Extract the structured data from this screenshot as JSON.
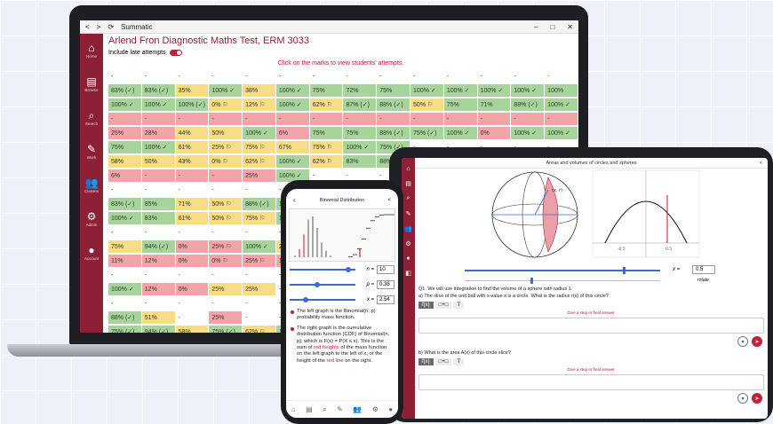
{
  "laptop": {
    "window_title": "Summatic",
    "nav_back": "<",
    "nav_forward": ">",
    "refresh_icon": "refresh-icon",
    "win_controls": [
      "–",
      "□",
      "✕"
    ],
    "test_title": "Arlend Fron Diagnostic Maths Test, ERM 3033",
    "late_attempts_label": "Include late attempts",
    "late_attempts_on": true,
    "hint": "Click on the marks to view students' attempts.",
    "sidebar": [
      {
        "icon": "home-icon",
        "glyph": "⌂",
        "label": "Home"
      },
      {
        "icon": "book-icon",
        "glyph": "▤",
        "label": "Browse"
      },
      {
        "icon": "search-icon",
        "glyph": "⌕",
        "label": "Search"
      },
      {
        "icon": "work-icon",
        "glyph": "✎",
        "label": "Work"
      },
      {
        "icon": "classes-icon",
        "glyph": "👥",
        "label": "Classes"
      },
      {
        "icon": "admin-icon",
        "glyph": "⚙",
        "label": "Admin"
      },
      {
        "icon": "account-icon",
        "glyph": "●",
        "label": "Account"
      }
    ],
    "grid": [
      [
        [
          "-",
          "n"
        ],
        [
          "-",
          "n"
        ],
        [
          "-",
          "n"
        ],
        [
          "-",
          "n"
        ],
        [
          "-",
          "n"
        ],
        [
          "-",
          "n"
        ],
        [
          "-",
          "n"
        ],
        [
          "-",
          "n"
        ],
        [
          "-",
          "n"
        ],
        [
          "-",
          "n"
        ],
        [
          "-",
          "n"
        ],
        [
          "-",
          "n"
        ],
        [
          "-",
          "n"
        ],
        [
          "-",
          "n"
        ]
      ],
      [
        [
          "83% (✓)",
          "g"
        ],
        [
          "83% (✓)",
          "g"
        ],
        [
          "35%",
          "y"
        ],
        [
          "100% ✓",
          "g"
        ],
        [
          "38%",
          "y"
        ],
        [
          "100% ✓",
          "g"
        ],
        [
          "75%",
          "g"
        ],
        [
          "72%",
          "g"
        ],
        [
          "75%",
          "g"
        ],
        [
          "100% ✓",
          "g"
        ],
        [
          "100% ✓",
          "g"
        ],
        [
          "100% ✓",
          "g"
        ],
        [
          "100% ✓",
          "g"
        ],
        [
          "100%",
          "g"
        ]
      ],
      [
        [
          "100% ✓",
          "g"
        ],
        [
          "100% ✓",
          "g"
        ],
        [
          "100% (✓)",
          "g"
        ],
        [
          "0% ⚐",
          "y"
        ],
        [
          "12% ⚐",
          "y"
        ],
        [
          "100% ✓",
          "g"
        ],
        [
          "62% ⚐",
          "y"
        ],
        [
          "87% (✓)",
          "g"
        ],
        [
          "88% (✓)",
          "g"
        ],
        [
          "50% ⚐",
          "y"
        ],
        [
          "75%",
          "g"
        ],
        [
          "71%",
          "g"
        ],
        [
          "88% (✓)",
          "g"
        ],
        [
          "100% ✓",
          "g"
        ]
      ],
      [
        [
          "-",
          "r"
        ],
        [
          "-",
          "r"
        ],
        [
          "-",
          "r"
        ],
        [
          "-",
          "r"
        ],
        [
          "-",
          "r"
        ],
        [
          "-",
          "r"
        ],
        [
          "-",
          "r"
        ],
        [
          "-",
          "r"
        ],
        [
          "-",
          "r"
        ],
        [
          "-",
          "r"
        ],
        [
          "-",
          "r"
        ],
        [
          "-",
          "r"
        ],
        [
          "-",
          "r"
        ],
        [
          "-",
          "r"
        ]
      ],
      [
        [
          "25%",
          "r"
        ],
        [
          "28%",
          "r"
        ],
        [
          "44%",
          "y"
        ],
        [
          "50%",
          "y"
        ],
        [
          "100% ✓",
          "g"
        ],
        [
          "6%",
          "r"
        ],
        [
          "75%",
          "g"
        ],
        [
          "75%",
          "g"
        ],
        [
          "88% (✓)",
          "g"
        ],
        [
          "75% (✓)",
          "g"
        ],
        [
          "100% ✓",
          "g"
        ],
        [
          "0%",
          "r"
        ],
        [
          "100% ✓",
          "g"
        ],
        [
          "100% ✓",
          "g"
        ]
      ],
      [
        [
          "75%",
          "g"
        ],
        [
          "100% ✓",
          "g"
        ],
        [
          "61%",
          "y"
        ],
        [
          "25% ⚐",
          "y"
        ],
        [
          "75% ⚐",
          "y"
        ],
        [
          "67%",
          "y"
        ],
        [
          "75% ⚐",
          "y"
        ],
        [
          "100% ✓",
          "g"
        ],
        [
          "75% (✓)",
          "g"
        ],
        [
          "-",
          "n"
        ],
        [
          "-",
          "n"
        ],
        [
          "-",
          "n"
        ],
        [
          "-",
          "n"
        ],
        [
          "-",
          "n"
        ]
      ],
      [
        [
          "58%",
          "y"
        ],
        [
          "50%",
          "y"
        ],
        [
          "43%",
          "y"
        ],
        [
          "0% ⚐",
          "y"
        ],
        [
          "62% ⚐",
          "y"
        ],
        [
          "100% ✓",
          "g"
        ],
        [
          "62% ⚐",
          "y"
        ],
        [
          "83%",
          "g"
        ],
        [
          "88% (✓)",
          "g"
        ],
        [
          "-",
          "n"
        ],
        [
          "-",
          "n"
        ],
        [
          "-",
          "n"
        ],
        [
          "-",
          "n"
        ],
        [
          "-",
          "n"
        ]
      ],
      [
        [
          "6%",
          "r"
        ],
        [
          "-",
          "r"
        ],
        [
          "-",
          "r"
        ],
        [
          "-",
          "r"
        ],
        [
          "25%",
          "r"
        ],
        [
          "100% ✓",
          "g"
        ],
        [
          "-",
          "n"
        ],
        [
          "-",
          "n"
        ],
        [
          "-",
          "n"
        ],
        [
          "-",
          "n"
        ],
        [
          "-",
          "n"
        ],
        [
          "-",
          "n"
        ],
        [
          "-",
          "n"
        ],
        [
          "-",
          "n"
        ]
      ],
      [
        [
          "-",
          "n"
        ],
        [
          "-",
          "n"
        ],
        [
          "-",
          "n"
        ],
        [
          "-",
          "n"
        ],
        [
          "-",
          "n"
        ],
        [
          "-",
          "n"
        ],
        [
          "-",
          "n"
        ],
        [
          "-",
          "n"
        ],
        [
          "-",
          "n"
        ],
        [
          "-",
          "n"
        ],
        [
          "-",
          "n"
        ],
        [
          "-",
          "n"
        ],
        [
          "-",
          "n"
        ],
        [
          "-",
          "n"
        ]
      ],
      [
        [
          "83% (✓)",
          "g"
        ],
        [
          "85%",
          "g"
        ],
        [
          "71%",
          "y"
        ],
        [
          "50% ⚐",
          "y"
        ],
        [
          "88% (✓)",
          "g"
        ],
        [
          "100% ✓",
          "g"
        ],
        [
          "-",
          "n"
        ],
        [
          "-",
          "n"
        ],
        [
          "-",
          "n"
        ],
        [
          "-",
          "n"
        ],
        [
          "-",
          "n"
        ],
        [
          "-",
          "n"
        ],
        [
          "-",
          "n"
        ],
        [
          "-",
          "n"
        ]
      ],
      [
        [
          "100% ✓",
          "g"
        ],
        [
          "83%",
          "g"
        ],
        [
          "61%",
          "y"
        ],
        [
          "50% ⚐",
          "y"
        ],
        [
          "75% ⚐",
          "y"
        ],
        [
          "100% ✓",
          "g"
        ],
        [
          "-",
          "n"
        ],
        [
          "-",
          "n"
        ],
        [
          "-",
          "n"
        ],
        [
          "-",
          "n"
        ],
        [
          "-",
          "n"
        ],
        [
          "-",
          "n"
        ],
        [
          "-",
          "n"
        ],
        [
          "-",
          "n"
        ]
      ],
      [
        [
          "-",
          "n"
        ],
        [
          "-",
          "n"
        ],
        [
          "-",
          "n"
        ],
        [
          "-",
          "n"
        ],
        [
          "-",
          "n"
        ],
        [
          "-",
          "n"
        ],
        [
          "-",
          "n"
        ],
        [
          "-",
          "n"
        ],
        [
          "-",
          "n"
        ],
        [
          "-",
          "n"
        ],
        [
          "-",
          "n"
        ],
        [
          "-",
          "n"
        ],
        [
          "-",
          "n"
        ],
        [
          "-",
          "n"
        ]
      ],
      [
        [
          "75%",
          "y"
        ],
        [
          "94% (✓)",
          "g"
        ],
        [
          "0%",
          "r"
        ],
        [
          "25% ⚐",
          "r"
        ],
        [
          "100% ✓",
          "g"
        ],
        [
          "25%",
          "y"
        ],
        [
          "-",
          "n"
        ],
        [
          "-",
          "n"
        ],
        [
          "-",
          "n"
        ],
        [
          "-",
          "n"
        ],
        [
          "-",
          "n"
        ],
        [
          "-",
          "n"
        ],
        [
          "-",
          "n"
        ],
        [
          "-",
          "n"
        ]
      ],
      [
        [
          "11%",
          "r"
        ],
        [
          "12%",
          "r"
        ],
        [
          "0%",
          "r"
        ],
        [
          "0% ⚐",
          "r"
        ],
        [
          "25% ⚐",
          "r"
        ],
        [
          "12%",
          "r"
        ],
        [
          "-",
          "n"
        ],
        [
          "-",
          "n"
        ],
        [
          "-",
          "n"
        ],
        [
          "-",
          "n"
        ],
        [
          "-",
          "n"
        ],
        [
          "-",
          "n"
        ],
        [
          "-",
          "n"
        ],
        [
          "-",
          "n"
        ]
      ],
      [
        [
          "-",
          "n"
        ],
        [
          "-",
          "n"
        ],
        [
          "-",
          "n"
        ],
        [
          "-",
          "n"
        ],
        [
          "-",
          "n"
        ],
        [
          "-",
          "n"
        ],
        [
          "-",
          "n"
        ],
        [
          "-",
          "n"
        ],
        [
          "-",
          "n"
        ],
        [
          "-",
          "n"
        ],
        [
          "-",
          "n"
        ],
        [
          "-",
          "n"
        ],
        [
          "-",
          "n"
        ],
        [
          "-",
          "n"
        ]
      ],
      [
        [
          "100% ✓",
          "g"
        ],
        [
          "12%",
          "r"
        ],
        [
          "0%",
          "r"
        ],
        [
          "25%",
          "y"
        ],
        [
          "25%",
          "y"
        ],
        [
          "-",
          "n"
        ],
        [
          "-",
          "n"
        ],
        [
          "-",
          "n"
        ],
        [
          "-",
          "n"
        ],
        [
          "-",
          "n"
        ],
        [
          "-",
          "n"
        ],
        [
          "-",
          "n"
        ],
        [
          "-",
          "n"
        ],
        [
          "-",
          "n"
        ]
      ],
      [
        [
          "-",
          "n"
        ],
        [
          "-",
          "n"
        ],
        [
          "-",
          "n"
        ],
        [
          "-",
          "n"
        ],
        [
          "-",
          "n"
        ],
        [
          "-",
          "n"
        ],
        [
          "-",
          "n"
        ],
        [
          "-",
          "n"
        ],
        [
          "-",
          "n"
        ],
        [
          "-",
          "n"
        ],
        [
          "-",
          "n"
        ],
        [
          "-",
          "n"
        ],
        [
          "-",
          "n"
        ],
        [
          "-",
          "n"
        ]
      ],
      [
        [
          "88% (✓)",
          "g"
        ],
        [
          "51%",
          "y"
        ],
        [
          "-",
          "n"
        ],
        [
          "25%",
          "r"
        ],
        [
          "-",
          "n"
        ],
        [
          "-",
          "n"
        ],
        [
          "-",
          "n"
        ],
        [
          "-",
          "n"
        ],
        [
          "-",
          "n"
        ],
        [
          "-",
          "n"
        ],
        [
          "-",
          "n"
        ],
        [
          "-",
          "n"
        ],
        [
          "-",
          "n"
        ],
        [
          "-",
          "n"
        ]
      ],
      [
        [
          "75% (✓)",
          "g"
        ],
        [
          "94% (✓)",
          "g"
        ],
        [
          "58%",
          "y"
        ],
        [
          "75% (✓)",
          "g"
        ],
        [
          "62% ⚐",
          "y"
        ],
        [
          "100% ✓",
          "g"
        ],
        [
          "-",
          "n"
        ],
        [
          "-",
          "n"
        ],
        [
          "-",
          "n"
        ],
        [
          "-",
          "n"
        ],
        [
          "-",
          "n"
        ],
        [
          "-",
          "n"
        ],
        [
          "-",
          "n"
        ],
        [
          "-",
          "n"
        ]
      ]
    ]
  },
  "tablet": {
    "title": "Areas and volumes of circles and spheres",
    "share_icon": "share-icon",
    "point_label": "(x, r)",
    "axis_ticks": [
      "-0.5",
      "0.5"
    ],
    "x_label": "x =",
    "x_value": "0.5",
    "rotate_label": "rotate",
    "question_intro": "Q1. We will use integration to find the volume of a sphere with radius 1.",
    "part_a": "a) The slice of the unit ball with x-value x is a circle. What is the radius r(x) of this circle?",
    "part_b": "b) What is the area A(x) of this circle slice?",
    "tools": [
      "f(x)",
      "□+□",
      "T"
    ],
    "step_hint": "Give a step or final answer.",
    "sidebar_glyphs": [
      "⌂",
      "▤",
      "⌕",
      "✎",
      "👥",
      "⚙",
      "●",
      "◧"
    ]
  },
  "phone": {
    "title": "Binomial Distribution",
    "back": "‹",
    "share": "<",
    "sliders": [
      {
        "var": "n =",
        "value": "10",
        "level": 0.85
      },
      {
        "var": "p =",
        "value": "0.38",
        "level": 0.38
      },
      {
        "var": "x =",
        "value": "2.54",
        "level": 0.2
      }
    ],
    "text1": "The left graph is the Binomial(n, p) probability mass function.",
    "text2_a": "The right graph is the cumulative distribution function (CDF) of Binomial(n, p), which is F(x) = P(X ≤ x). This is the sum of",
    "text2_red1": "red heights",
    "text2_b": "of the mass function on the left graph to the left of x, or the height of the",
    "text2_red2": "red line",
    "text2_c": "on the right.",
    "pmf": [
      0.01,
      0.05,
      0.14,
      0.23,
      0.25,
      0.18,
      0.09,
      0.04,
      0.01,
      0.0,
      0.0
    ],
    "nav": [
      "⌂",
      "▤",
      "⌕",
      "✎",
      "👥",
      "⚙",
      "●"
    ]
  },
  "colors": {
    "brand": "#8c2034",
    "accent_red": "#c0213a",
    "slider_blue": "#3c6ad8"
  }
}
